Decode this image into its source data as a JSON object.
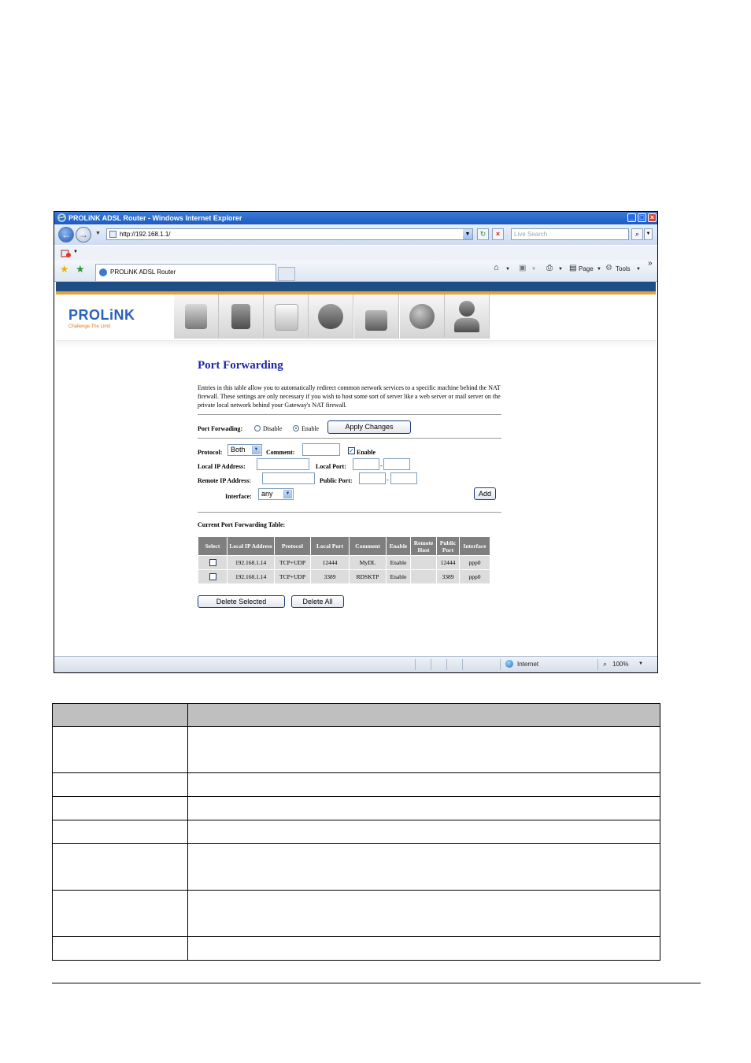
{
  "browser": {
    "title": "PROLiNK ADSL Router - Windows Internet Explorer",
    "url": "http://192.168.1.1/",
    "search_placeholder": "Live Search",
    "tab_label": "PROLiNK ADSL Router",
    "page_label": "Page",
    "tools_label": "Tools",
    "status_zone": "Internet",
    "zoom": "100%"
  },
  "brand": {
    "logo": "PROLiNK",
    "slogan": "Challenge The Limit"
  },
  "port_forwarding": {
    "title": "Port Forwarding",
    "description": "Entries in this table allow you to automatically redirect common network services to a specific machine behind the NAT firewall. These settings are only necessary if you wish to host some sort of server like a web server or mail server on the private local network behind your Gateway's NAT firewall.",
    "forwarding_label": "Port Forwading:",
    "disable_label": "Disable",
    "enable_label": "Enable",
    "apply_button": "Apply Changes",
    "protocol_label": "Protocol:",
    "protocol_value": "Both",
    "comment_label": "Comment:",
    "entry_enable_label": "Enable",
    "local_ip_label": "Local IP Address:",
    "local_port_label": "Local Port:",
    "remote_ip_label": "Remote IP Address:",
    "public_port_label": "Public Port:",
    "interface_label": "Interface:",
    "interface_value": "any",
    "add_button": "Add",
    "table_title": "Current Port Forwarding Table:",
    "columns": [
      "Select",
      "Local IP Address",
      "Protocol",
      "Local Port",
      "Comment",
      "Enable",
      "Remote Host",
      "Public Port",
      "Interface"
    ],
    "rows": [
      {
        "local_ip": "192.168.1.14",
        "protocol": "TCP+UDP",
        "local_port": "12444",
        "comment": "MyDL",
        "enable": "Enable",
        "remote_host": "",
        "public_port": "12444",
        "interface": "ppp0"
      },
      {
        "local_ip": "192.168.1.14",
        "protocol": "TCP+UDP",
        "local_port": "3389",
        "comment": "RDSKTP",
        "enable": "Enable",
        "remote_host": "",
        "public_port": "3389",
        "interface": "ppp0"
      }
    ],
    "delete_selected_button": "Delete Selected",
    "delete_all_button": "Delete All"
  }
}
